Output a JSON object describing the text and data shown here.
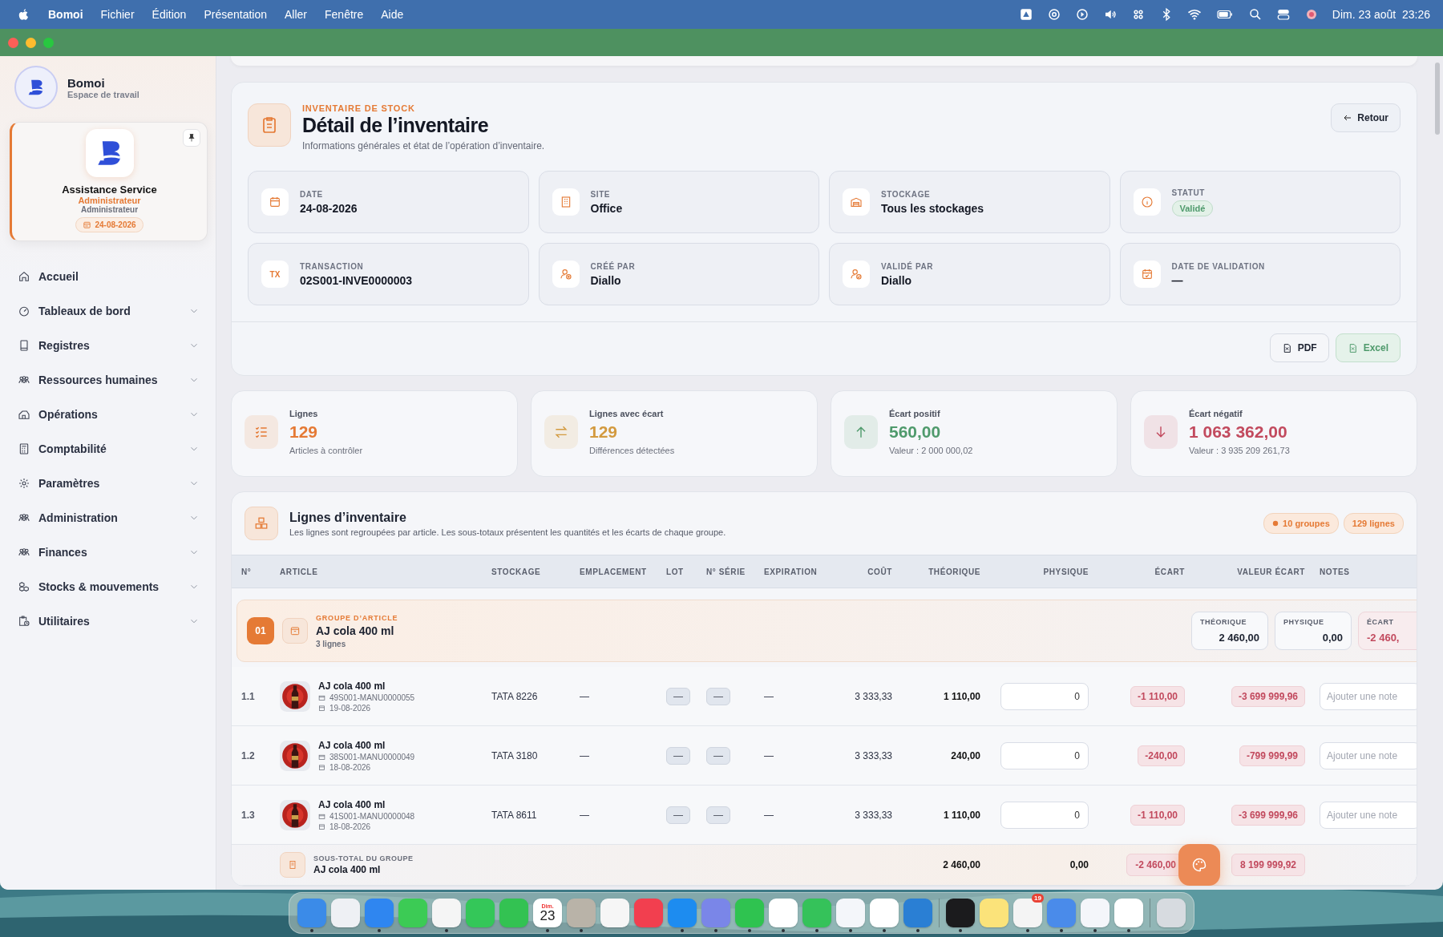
{
  "menubar": {
    "app": "Bomoi",
    "menus": [
      "Fichier",
      "Édition",
      "Présentation",
      "Aller",
      "Fenêtre",
      "Aide"
    ],
    "clock": "Dim. 23 août  23:26"
  },
  "sidebar": {
    "brand": "Bomoi",
    "workspace": "Espace de travail",
    "user": {
      "name": "Assistance Service",
      "role": "Administrateur",
      "subrole": "Administrateur",
      "date": "24-08-2026"
    },
    "items": [
      {
        "label": "Accueil",
        "expandable": false
      },
      {
        "label": "Tableaux de bord",
        "expandable": true
      },
      {
        "label": "Registres",
        "expandable": true
      },
      {
        "label": "Ressources humaines",
        "expandable": true
      },
      {
        "label": "Opérations",
        "expandable": true
      },
      {
        "label": "Comptabilité",
        "expandable": true
      },
      {
        "label": "Paramètres",
        "expandable": true
      },
      {
        "label": "Administration",
        "expandable": true
      },
      {
        "label": "Finances",
        "expandable": true
      },
      {
        "label": "Stocks & mouvements",
        "expandable": true
      },
      {
        "label": "Utilitaires",
        "expandable": true
      }
    ]
  },
  "header": {
    "eyebrow": "INVENTAIRE DE STOCK",
    "title": "Détail de l’inventaire",
    "subtitle": "Informations générales et état de l’opération d’inventaire.",
    "back": "Retour",
    "fields": [
      {
        "label": "DATE",
        "value": "24-08-2026",
        "kind": "value"
      },
      {
        "label": "SITE",
        "value": "Office",
        "kind": "value"
      },
      {
        "label": "STOCKAGE",
        "value": "Tous les stockages",
        "kind": "value"
      },
      {
        "label": "STATUT",
        "value": "Validé",
        "kind": "status"
      },
      {
        "label": "TRANSACTION",
        "value": "02S001-INVE0000003",
        "kind": "value",
        "icon_text": "TX"
      },
      {
        "label": "CRÉÉ PAR",
        "value": "Diallo",
        "kind": "value"
      },
      {
        "label": "VALIDÉ PAR",
        "value": "Diallo",
        "kind": "value"
      },
      {
        "label": "DATE DE VALIDATION",
        "value": "—",
        "kind": "value"
      }
    ],
    "exports": [
      {
        "label": "PDF",
        "kind": "neutral"
      },
      {
        "label": "Excel",
        "kind": "success"
      }
    ]
  },
  "stats": [
    {
      "label": "Lignes",
      "value": "129",
      "note": "Articles à contrôler",
      "color": "#e57a35"
    },
    {
      "label": "Lignes avec écart",
      "value": "129",
      "note": "Différences détectées",
      "color": "#d39a3f"
    },
    {
      "label": "Écart positif",
      "value": "560,00",
      "note": "Valeur : 2 000 000,02",
      "color": "#4f9a6c"
    },
    {
      "label": "Écart négatif",
      "value": "1 063 362,00",
      "note": "Valeur : 3 935 209 261,73",
      "color": "#c24a5e"
    }
  ],
  "lines": {
    "title": "Lignes d’inventaire",
    "description": "Les lignes sont regroupées par article. Les sous-totaux présentent les quantités et les écarts de chaque groupe.",
    "chips": [
      "10 groupes",
      "129 lignes"
    ],
    "columns": [
      "N°",
      "ARTICLE",
      "STOCKAGE",
      "EMPLACEMENT",
      "LOT",
      "N° SÉRIE",
      "EXPIRATION",
      "COÛT",
      "THÉORIQUE",
      "PHYSIQUE",
      "ÉCART",
      "VALEUR ÉCART",
      "NOTES"
    ],
    "group": {
      "number": "01",
      "eyebrow": "GROUPE D’ARTICLE",
      "name": "AJ cola 400 ml",
      "count": "3 lignes",
      "totals": [
        {
          "label": "THÉORIQUE",
          "value": "2 460,00",
          "kind": "plain"
        },
        {
          "label": "PHYSIQUE",
          "value": "0,00",
          "kind": "plain"
        },
        {
          "label": "ÉCART",
          "value": "-2 460,",
          "kind": "negative"
        }
      ]
    },
    "rows": [
      {
        "no": "1.1",
        "article": "AJ cola 400 ml",
        "lot_code": "49S001-MANU0000055",
        "date": "19-08-2026",
        "storage": "TATA 8226",
        "location": "—",
        "lot": "—",
        "serial": "—",
        "expiration": "—",
        "cost": "3 333,33",
        "theoretical": "1 110,00",
        "physical": "0",
        "gap": "-1 110,00",
        "gap_value": "-3 699 999,96",
        "notes_placeholder": "Ajouter une note"
      },
      {
        "no": "1.2",
        "article": "AJ cola 400 ml",
        "lot_code": "38S001-MANU0000049",
        "date": "18-08-2026",
        "storage": "TATA 3180",
        "location": "—",
        "lot": "—",
        "serial": "—",
        "expiration": "—",
        "cost": "3 333,33",
        "theoretical": "240,00",
        "physical": "0",
        "gap": "-240,00",
        "gap_value": "-799 999,99",
        "notes_placeholder": "Ajouter une note"
      },
      {
        "no": "1.3",
        "article": "AJ cola 400 ml",
        "lot_code": "41S001-MANU0000048",
        "date": "18-08-2026",
        "storage": "TATA 8611",
        "location": "—",
        "lot": "—",
        "serial": "—",
        "expiration": "—",
        "cost": "3 333,33",
        "theoretical": "1 110,00",
        "physical": "0",
        "gap": "-1 110,00",
        "gap_value": "-3 699 999,96",
        "notes_placeholder": "Ajouter une note"
      }
    ],
    "subtotal": {
      "label": "SOUS-TOTAL DU GROUPE",
      "name": "AJ cola 400 ml",
      "theoretical": "2 460,00",
      "physical": "0,00",
      "gap": "-2 460,00",
      "gap_value": "8 199 999,92"
    }
  },
  "dock": {
    "apps": [
      {
        "color": "#3b8be8",
        "running": true
      },
      {
        "color": "#eef0f4",
        "running": false
      },
      {
        "color": "#2f86f0",
        "running": true
      },
      {
        "color": "#3ccb55",
        "running": false
      },
      {
        "color": "#f5f5f5",
        "running": true
      },
      {
        "color": "#34c759",
        "running": false
      },
      {
        "color": "#33c252",
        "running": false
      },
      {
        "color": "#ffffff",
        "running": true,
        "top": "Dim.",
        "day": "23"
      },
      {
        "color": "#b9b3a8",
        "running": true
      },
      {
        "color": "#f6f6f6",
        "running": false
      },
      {
        "color": "#f23f4f",
        "running": false
      },
      {
        "color": "#1d8cf0",
        "running": true
      },
      {
        "color": "#7a86e8",
        "running": true
      },
      {
        "color": "#2fc350",
        "running": true
      },
      {
        "color": "#ffffff",
        "running": true
      },
      {
        "color": "#35c25a",
        "running": true
      },
      {
        "color": "#f4f6fa",
        "running": true
      },
      {
        "color": "#ffffff",
        "running": true
      },
      {
        "color": "#2a7fd4",
        "running": true
      },
      {
        "color": "#1b1b1d",
        "running": true,
        "separator": true
      },
      {
        "color": "#fbe37a",
        "running": false
      },
      {
        "color": "#f4f4f4",
        "running": true,
        "badge": "19"
      },
      {
        "color": "#4a8bea",
        "running": true
      },
      {
        "color": "#f4f6fa",
        "running": true
      },
      {
        "color": "#ffffff",
        "running": true
      },
      {
        "color": "#d7dbe0",
        "running": false,
        "separator": true
      }
    ]
  }
}
